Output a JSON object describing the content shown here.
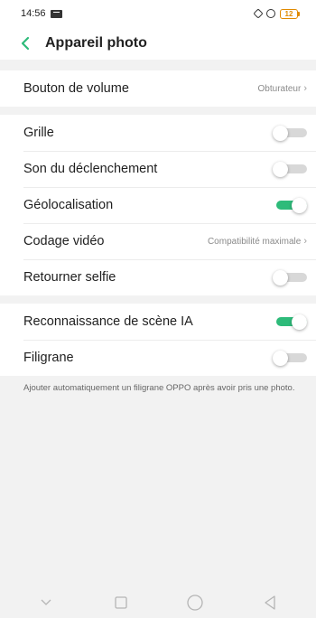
{
  "status_bar": {
    "time": "14:56",
    "battery": "12"
  },
  "header": {
    "title": "Appareil photo"
  },
  "section1": {
    "volume_button": {
      "label": "Bouton de volume",
      "value": "Obturateur"
    }
  },
  "section2": {
    "grid": {
      "label": "Grille",
      "on": false
    },
    "shutter_sound": {
      "label": "Son du déclenchement",
      "on": false
    },
    "geolocation": {
      "label": "Géolocalisation",
      "on": true
    },
    "video_codec": {
      "label": "Codage vidéo",
      "value": "Compatibilité maximale"
    },
    "mirror_selfie": {
      "label": "Retourner selfie",
      "on": false
    }
  },
  "section3": {
    "ai_scene": {
      "label": "Reconnaissance de scène IA",
      "on": true
    },
    "watermark": {
      "label": "Filigrane",
      "on": false
    }
  },
  "footnote": "Ajouter automatiquement un filigrane OPPO après avoir pris une photo.",
  "colors": {
    "accent": "#2ebb7a",
    "battery": "#e08a00"
  },
  "icons": {
    "back": "chevron-left-icon",
    "nav_collapse": "chevron-down-icon",
    "nav_recents": "square-icon",
    "nav_home": "circle-icon",
    "nav_back": "triangle-left-icon"
  }
}
